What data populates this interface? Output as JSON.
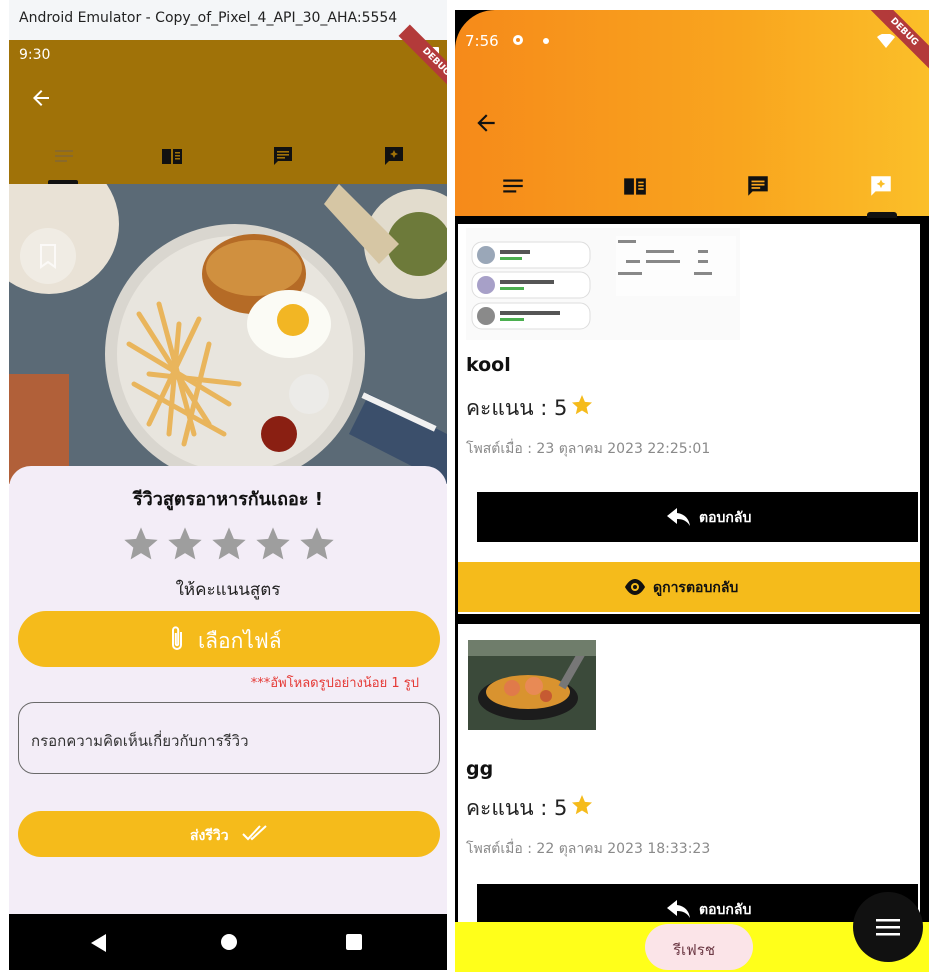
{
  "left_phone": {
    "window_title": "Android Emulator - Copy_of_Pixel_4_API_30_AHA:5554",
    "status_time": "9:30",
    "debug_banner": "DEBUG",
    "review_sheet": {
      "title": "รีวิวสูตรอาหารกันเถอะ !",
      "rating_label": "ให้คะแนนสูตร",
      "stars": 5,
      "pick_file_label": "เลือกไฟล์",
      "upload_warning": "***อัพโหลดรูปอย่างน้อย 1 รูป",
      "comment_placeholder": "กรอกความคิดเห็นเกี่ยวกับการรีวิว",
      "send_label": "ส่งรีวิว"
    },
    "colors": {
      "accent": "#f5bb1b",
      "appbar": "#a07208",
      "sheet": "#f3edf7"
    }
  },
  "right_phone": {
    "status_time": "7:56",
    "debug_banner": "DEBUG",
    "reviews": [
      {
        "name": "kool",
        "score_label": "คะแนน : 5",
        "posted": "โพสต์เมื่อ : 23 ตุลาคม 2023 22:25:01",
        "reply_label": "ตอบกลับ",
        "view_replies_label": "ดูการตอบกลับ"
      },
      {
        "name": "gg",
        "score_label": "คะแนน : 5",
        "posted": "โพสต์เมื่อ : 22 ตุลาคม 2023 18:33:23",
        "reply_label": "ตอบกลับ"
      }
    ],
    "refresh_label": "รีเฟรช",
    "colors": {
      "accent": "#f5bb1b",
      "gradient_start": "#f68a1a",
      "gradient_end": "#fbbf29",
      "bottom_bar": "#ffff1a"
    }
  }
}
